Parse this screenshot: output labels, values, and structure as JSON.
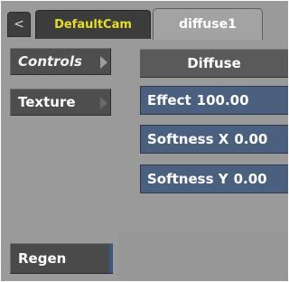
{
  "tabs": {
    "back_icon": "<",
    "camera_label": "DefaultCam",
    "active_label": "diffuse1"
  },
  "sidebar": {
    "items": [
      {
        "label": "Controls",
        "selected": true
      },
      {
        "label": "Texture",
        "selected": false
      }
    ],
    "regen_label": "Regen"
  },
  "main": {
    "header_label": "Diffuse",
    "fields": [
      {
        "label": "Effect",
        "value": "100.00"
      },
      {
        "label": "Softness X",
        "value": "0.00"
      },
      {
        "label": "Softness Y",
        "value": "0.00"
      }
    ]
  },
  "colors": {
    "camera_tab_text": "#e8dc2a",
    "field_bg": "#4b607e",
    "panel_bg": "#9a9a9a",
    "regen_accent": "#3a5a86"
  }
}
